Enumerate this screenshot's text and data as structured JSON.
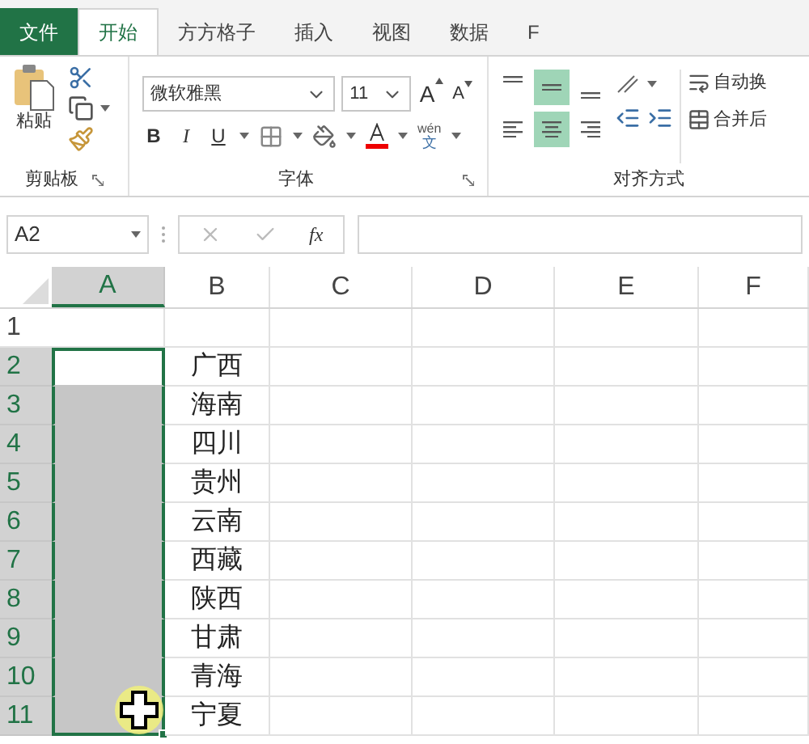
{
  "tabs": [
    {
      "label": "文件",
      "kind": "file",
      "selected": false
    },
    {
      "label": "开始",
      "kind": "tab",
      "selected": true
    },
    {
      "label": "方方格子",
      "kind": "tab",
      "selected": false
    },
    {
      "label": "插入",
      "kind": "tab",
      "selected": false
    },
    {
      "label": "视图",
      "kind": "tab",
      "selected": false
    },
    {
      "label": "数据",
      "kind": "tab",
      "selected": false
    },
    {
      "label": "F",
      "kind": "tab",
      "selected": false
    }
  ],
  "clipboard": {
    "paste": "粘贴",
    "label": "剪贴板"
  },
  "font": {
    "name": "微软雅黑",
    "size": "11",
    "grow": "A",
    "shrink": "A",
    "bold": "B",
    "italic": "I",
    "underline": "U",
    "phonetic_top": "wén",
    "phonetic_bottom": "文",
    "label": "字体"
  },
  "alignment": {
    "vertical": [
      {
        "kind": "top",
        "selected": false
      },
      {
        "kind": "middle",
        "selected": true
      },
      {
        "kind": "bottom",
        "selected": false
      }
    ],
    "horizontal": [
      {
        "kind": "left",
        "selected": false
      },
      {
        "kind": "center",
        "selected": true
      },
      {
        "kind": "right",
        "selected": false
      }
    ],
    "wrap": "自动换",
    "merge": "合并后",
    "label": "对齐方式"
  },
  "name_box": "A2",
  "formula_bar": {
    "fx": "fx"
  },
  "columns": [
    {
      "label": "A",
      "selected": true
    },
    {
      "label": "B",
      "selected": false
    },
    {
      "label": "C",
      "selected": false
    },
    {
      "label": "D",
      "selected": false
    },
    {
      "label": "E",
      "selected": false
    },
    {
      "label": "F",
      "selected": false
    }
  ],
  "rows": [
    {
      "label": "1",
      "selected": false,
      "cells": [
        {
          "selected": false
        },
        {
          "selected": false
        },
        {
          "selected": false
        },
        {
          "selected": false
        },
        {
          "selected": false
        },
        {
          "selected": false
        }
      ]
    },
    {
      "label": "2",
      "selected": true,
      "cells": [
        {
          "selected": true,
          "active": true
        },
        {
          "text": "广西",
          "selected": false
        },
        {
          "selected": false
        },
        {
          "selected": false
        },
        {
          "selected": false
        },
        {
          "selected": false
        }
      ]
    },
    {
      "label": "3",
      "selected": true,
      "cells": [
        {
          "selected": true
        },
        {
          "text": "海南",
          "selected": false
        },
        {
          "selected": false
        },
        {
          "selected": false
        },
        {
          "selected": false
        },
        {
          "selected": false
        }
      ]
    },
    {
      "label": "4",
      "selected": true,
      "cells": [
        {
          "selected": true
        },
        {
          "text": "四川",
          "selected": false
        },
        {
          "selected": false
        },
        {
          "selected": false
        },
        {
          "selected": false
        },
        {
          "selected": false
        }
      ]
    },
    {
      "label": "5",
      "selected": true,
      "cells": [
        {
          "selected": true
        },
        {
          "text": "贵州",
          "selected": false
        },
        {
          "selected": false
        },
        {
          "selected": false
        },
        {
          "selected": false
        },
        {
          "selected": false
        }
      ]
    },
    {
      "label": "6",
      "selected": true,
      "cells": [
        {
          "selected": true
        },
        {
          "text": "云南",
          "selected": false
        },
        {
          "selected": false
        },
        {
          "selected": false
        },
        {
          "selected": false
        },
        {
          "selected": false
        }
      ]
    },
    {
      "label": "7",
      "selected": true,
      "cells": [
        {
          "selected": true
        },
        {
          "text": "西藏",
          "selected": false
        },
        {
          "selected": false
        },
        {
          "selected": false
        },
        {
          "selected": false
        },
        {
          "selected": false
        }
      ]
    },
    {
      "label": "8",
      "selected": true,
      "cells": [
        {
          "selected": true
        },
        {
          "text": "陕西",
          "selected": false
        },
        {
          "selected": false
        },
        {
          "selected": false
        },
        {
          "selected": false
        },
        {
          "selected": false
        }
      ]
    },
    {
      "label": "9",
      "selected": true,
      "cells": [
        {
          "selected": true
        },
        {
          "text": "甘肃",
          "selected": false
        },
        {
          "selected": false
        },
        {
          "selected": false
        },
        {
          "selected": false
        },
        {
          "selected": false
        }
      ]
    },
    {
      "label": "10",
      "selected": true,
      "cells": [
        {
          "selected": true
        },
        {
          "text": "青海",
          "selected": false
        },
        {
          "selected": false
        },
        {
          "selected": false
        },
        {
          "selected": false
        },
        {
          "selected": false
        }
      ]
    },
    {
      "label": "11",
      "selected": true,
      "cells": [
        {
          "selected": true,
          "cursor": true
        },
        {
          "text": "宁夏",
          "selected": false
        },
        {
          "selected": false
        },
        {
          "selected": false
        },
        {
          "selected": false
        },
        {
          "selected": false
        }
      ]
    }
  ]
}
